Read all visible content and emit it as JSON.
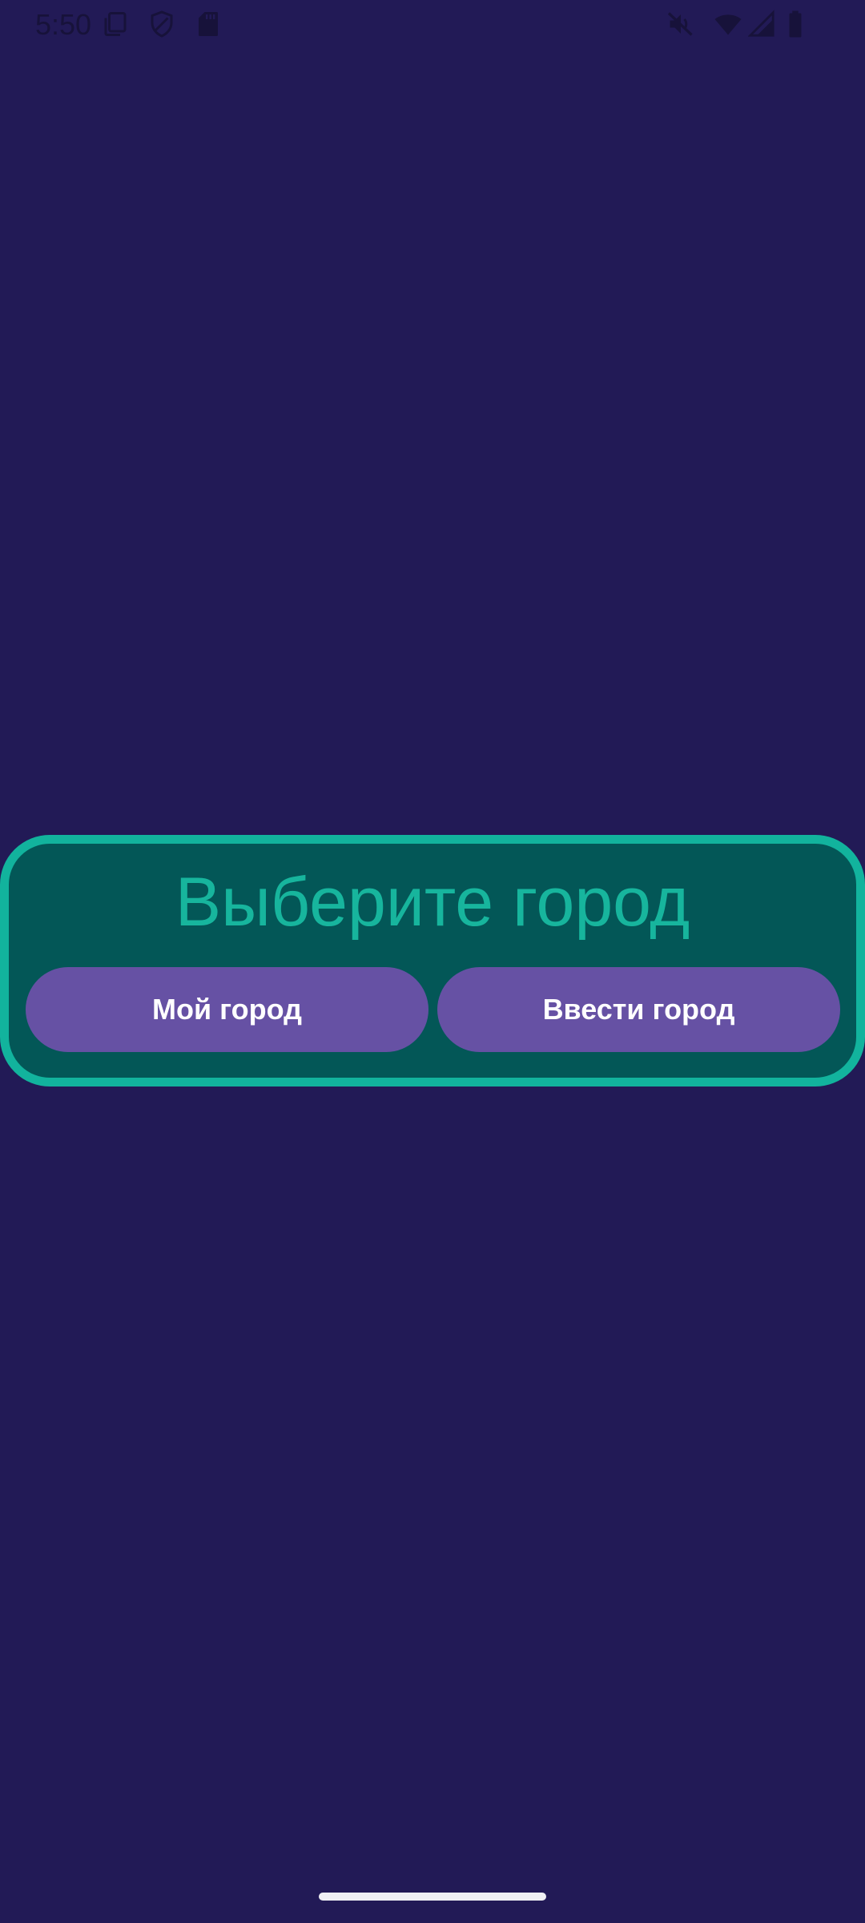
{
  "status_bar": {
    "time": "5:50",
    "icons": [
      "copy-icon",
      "shield-icon",
      "sd-card-icon",
      "mute-icon",
      "wifi-icon",
      "signal-icon",
      "battery-icon"
    ]
  },
  "card": {
    "title": "Выберите город",
    "my_city_label": "Мой город",
    "enter_city_label": "Ввести город"
  },
  "colors": {
    "background": "#221a56",
    "card_fill": "#035757",
    "card_border": "#12b39d",
    "title": "#17b59d",
    "button": "#6651a4",
    "button_text": "#ffffff"
  }
}
